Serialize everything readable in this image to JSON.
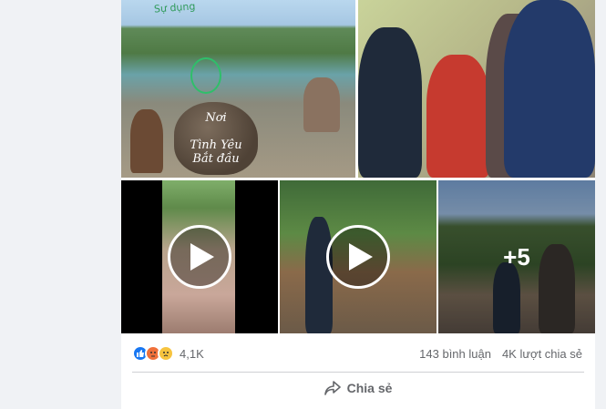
{
  "photos": {
    "photo1": {
      "rock_lines": [
        "Nơi",
        "Tình Yêu",
        "Bắt đầu"
      ],
      "hand_note": "Sự dụng"
    },
    "photo5": {
      "more_count": "+5"
    }
  },
  "footer": {
    "reaction_count": "4,1K",
    "comments": "143 bình luận",
    "shares": "4K lượt chia sẻ",
    "share_label": "Chia sẻ"
  },
  "icons": {
    "like": "like-reaction-icon",
    "angry": "angry-reaction-icon",
    "sad": "sad-reaction-icon",
    "play": "play-icon",
    "share": "share-arrow-icon"
  },
  "colors": {
    "like": "#1877f2",
    "angry": "#f0703a",
    "sad": "#f7c43f",
    "muted_text": "#65676b"
  }
}
